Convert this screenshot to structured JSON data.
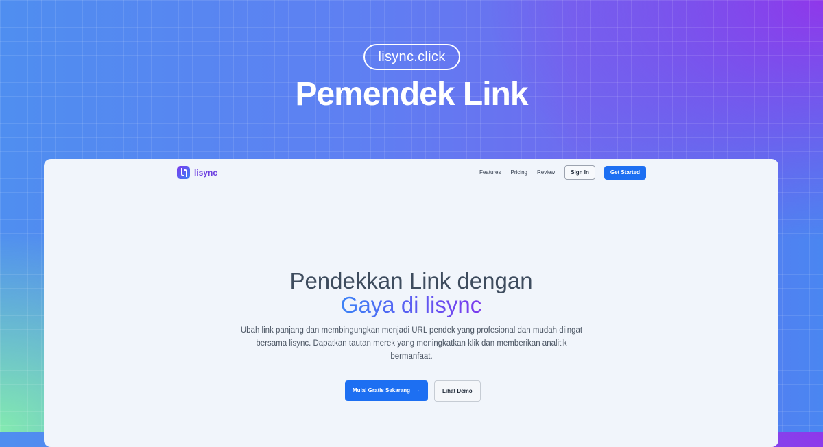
{
  "banner": {
    "domain_pill": "lisync.click",
    "headline": "Pemendek Link"
  },
  "navbar": {
    "brand_name": "lisync",
    "links": [
      "Features",
      "Pricing",
      "Review"
    ],
    "sign_in_label": "Sign In",
    "get_started_label": "Get Started"
  },
  "hero": {
    "title_plain": "Pendekkan Link dengan ",
    "title_accent": "Gaya di lisync",
    "subtitle": "Ubah link panjang dan membingungkan menjadi URL pendek yang profesional dan mudah diingat bersama lisync. Dapatkan tautan merek yang meningkatkan klik dan memberikan analitik bermanfaat.",
    "primary_cta": "Mulai Gratis Sekarang",
    "primary_cta_icon": "arrow-right-icon",
    "secondary_cta": "Lihat Demo"
  },
  "colors": {
    "accent_blue": "#1d6ff2",
    "brand_purple": "#7c3aed"
  }
}
